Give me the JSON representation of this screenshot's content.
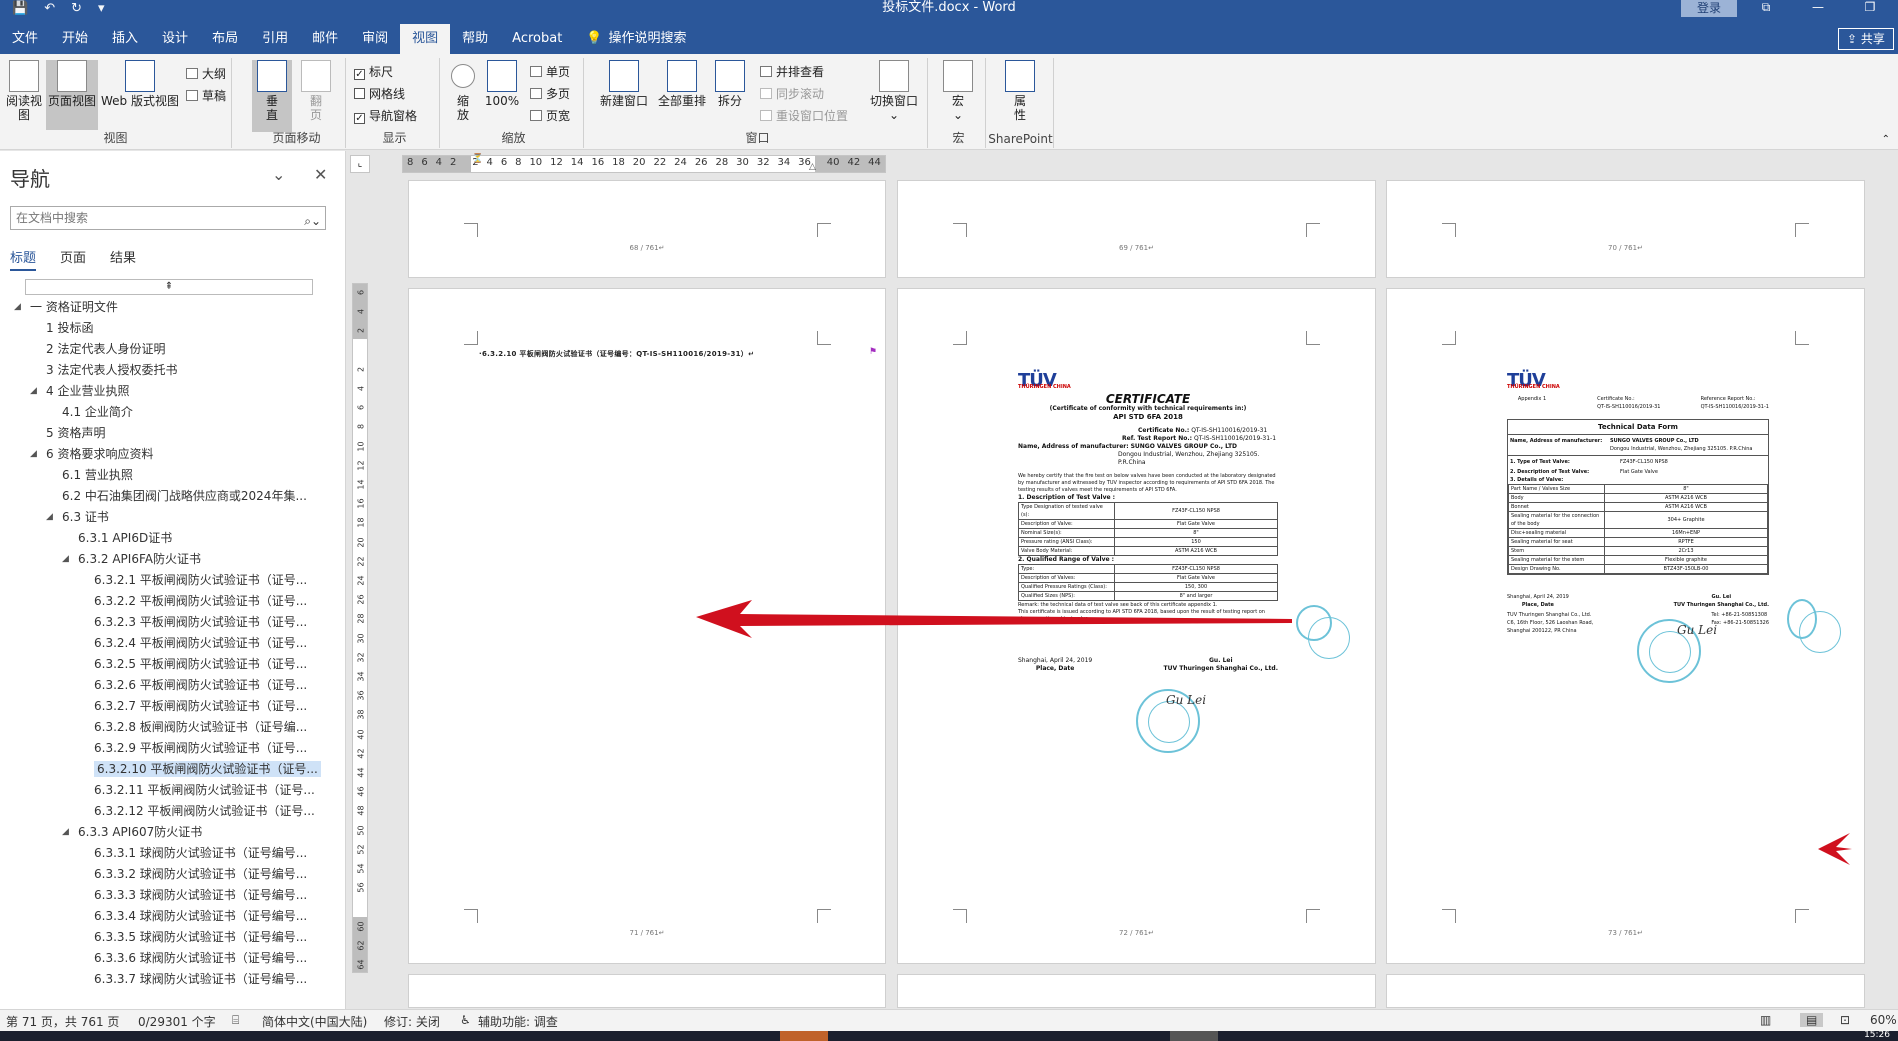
{
  "window": {
    "title": "投标文件.docx  -  Word",
    "login": "登录",
    "share": "共享"
  },
  "tabs": [
    {
      "label": "文件"
    },
    {
      "label": "开始"
    },
    {
      "label": "插入"
    },
    {
      "label": "设计"
    },
    {
      "label": "布局"
    },
    {
      "label": "引用"
    },
    {
      "label": "邮件"
    },
    {
      "label": "审阅"
    },
    {
      "label": "视图"
    },
    {
      "label": "帮助"
    },
    {
      "label": "Acrobat"
    },
    {
      "label": "操作说明搜索"
    }
  ],
  "ribbon": {
    "views": {
      "read": "阅读视图",
      "print": "页面视图",
      "web": "Web 版式视图",
      "outline": "大纲",
      "draft": "草稿",
      "label": "视图"
    },
    "page_move": {
      "vertical": "垂直",
      "side": "翻页",
      "label": "页面移动"
    },
    "show": {
      "ruler": "标尺",
      "gridlines": "网格线",
      "nav_pane": "导航窗格",
      "label": "显示"
    },
    "zoom": {
      "zoom": "缩放",
      "percent": "100%",
      "one_page": "单页",
      "multi_page": "多页",
      "page_width": "页宽",
      "label": "缩放"
    },
    "window": {
      "new_window": "新建窗口",
      "arrange_all": "全部重排",
      "split": "拆分",
      "side_by_side": "并排查看",
      "sync_scroll": "同步滚动",
      "reset_position": "重设窗口位置",
      "switch": "切换窗口",
      "label": "窗口"
    },
    "macros": {
      "macros": "宏",
      "label": "宏"
    },
    "sharepoint": {
      "properties": "属性",
      "label": "SharePoint"
    }
  },
  "nav": {
    "title": "导航",
    "search_placeholder": "在文档中搜索",
    "tabs": [
      "标题",
      "页面",
      "结果"
    ],
    "items": [
      {
        "text": "一 资格证明文件",
        "level": 0,
        "tri": "◢"
      },
      {
        "text": "1 投标函",
        "level": 1
      },
      {
        "text": "2 法定代表人身份证明",
        "level": 1
      },
      {
        "text": "3 法定代表人授权委托书",
        "level": 1
      },
      {
        "text": "4 企业营业执照",
        "level": 1,
        "tri": "◢"
      },
      {
        "text": "4.1 企业简介",
        "level": 2
      },
      {
        "text": "5 资格声明",
        "level": 1
      },
      {
        "text": "6 资格要求响应资料",
        "level": 1,
        "tri": "◢"
      },
      {
        "text": "6.1 营业执照",
        "level": 2
      },
      {
        "text": "6.2 中石油集团阀门战略供应商或2024年集...",
        "level": 2
      },
      {
        "text": "6.3 证书",
        "level": 2,
        "tri": "◢"
      },
      {
        "text": "6.3.1 API6D证书",
        "level": 3
      },
      {
        "text": "6.3.2 API6FA防火证书",
        "level": 3,
        "tri": "◢"
      },
      {
        "text": "6.3.2.1 平板闸阀防火试验证书（证号...",
        "level": 4
      },
      {
        "text": "6.3.2.2 平板闸阀防火试验证书（证号...",
        "level": 4
      },
      {
        "text": "6.3.2.3 平板闸阀防火试验证书（证号...",
        "level": 4
      },
      {
        "text": "6.3.2.4 平板闸阀防火试验证书（证号...",
        "level": 4
      },
      {
        "text": "6.3.2.5 平板闸阀防火试验证书（证号...",
        "level": 4
      },
      {
        "text": "6.3.2.6 平板闸阀防火试验证书（证号...",
        "level": 4
      },
      {
        "text": "6.3.2.7 平板闸阀防火试验证书（证号...",
        "level": 4
      },
      {
        "text": "6.3.2.8 板闸阀防火试验证书（证号编...",
        "level": 4
      },
      {
        "text": "6.3.2.9 平板闸阀防火试验证书（证号...",
        "level": 4
      },
      {
        "text": "6.3.2.10 平板闸阀防火试验证书（证号...",
        "level": 4,
        "selected": true
      },
      {
        "text": "6.3.2.11 平板闸阀防火试验证书（证号...",
        "level": 4
      },
      {
        "text": "6.3.2.12 平板闸阀防火试验证书（证号...",
        "level": 4
      },
      {
        "text": "6.3.3 API607防火证书",
        "level": 3,
        "tri": "◢"
      },
      {
        "text": "6.3.3.1 球阀防火试验证书（证号编号...",
        "level": 4
      },
      {
        "text": "6.3.3.2 球阀防火试验证书（证号编号...",
        "level": 4
      },
      {
        "text": "6.3.3.3 球阀防火试验证书（证号编号...",
        "level": 4
      },
      {
        "text": "6.3.3.4 球阀防火试验证书（证号编号...",
        "level": 4
      },
      {
        "text": "6.3.3.5 球阀防火试验证书（证号编号...",
        "level": 4
      },
      {
        "text": "6.3.3.6 球阀防火试验证书（证号编号...",
        "level": 4
      },
      {
        "text": "6.3.3.7 球阀防火试验证书（证号编号...",
        "level": 4
      }
    ]
  },
  "ruler": {
    "h_ticks": [
      "8",
      "6",
      "4",
      "2",
      "",
      "2",
      "4",
      "6",
      "8",
      "10",
      "12",
      "14",
      "16",
      "18",
      "20",
      "22",
      "24",
      "26",
      "28",
      "30",
      "32",
      "34",
      "36",
      "",
      "40",
      "42",
      "44"
    ],
    "v_ticks": [
      "6",
      "4",
      "2",
      "",
      "2",
      "4",
      "6",
      "8",
      "10",
      "12",
      "14",
      "16",
      "18",
      "20",
      "22",
      "24",
      "26",
      "28",
      "30",
      "32",
      "34",
      "36",
      "38",
      "40",
      "42",
      "44",
      "46",
      "48",
      "50",
      "52",
      "54",
      "56",
      "",
      "60",
      "62",
      "64"
    ]
  },
  "pages": {
    "p68": "68 / 761↵",
    "p69": "69 / 761↵",
    "p70": "70 / 761↵",
    "p71": "71 / 761↵",
    "p72": "72 / 761↵",
    "p73": "73 / 761↵",
    "heading": "·6.3.2.10    平板闸阀防火试验证书（证号编号：QT-IS-SH110016/2019-31）↵"
  },
  "certificate": {
    "brand": "TÜV",
    "brand_sub": "THÜRINGEN CHINA",
    "title": "CERTIFICATE",
    "subtitle": "(Certificate of conformity with technical requirements in:)",
    "standard": "API STD 6FA 2018",
    "cert_no_label": "Certificate No.:",
    "cert_no": "QT-IS-SH110016/2019-31",
    "report_no_label": "Ref. Test Report No.:",
    "report_no": "QT-IS-SH110016/2019-31-1",
    "mfr_label": "Name, Address of manufacturer:",
    "mfr": "SUNGO VALVES GROUP Co., LTD",
    "mfr_addr": "Dongou Industrial, Wenzhou, Zhejiang 325105. P.R.China",
    "body": "We hereby certify that the fire test on below valves have been conducted at the laboratory designated by manufacturer and witnessed by TUV inspector according to requirements of API STD 6FA 2018. The testing results of valves meet the requirements of API STD 6FA.",
    "sec1": "1. Description of Test Valve :",
    "rows1": [
      [
        "Type Designation of tested valve (s):",
        "FZ43F-CL150 NPS8"
      ],
      [
        "Description of Valve:",
        "Flat Gate Valve"
      ],
      [
        "Nominal Size(s):",
        "8\""
      ],
      [
        "Pressure rating (ANSI Class):",
        "150"
      ],
      [
        "Valve Body Material:",
        "ASTM A216 WCB"
      ]
    ],
    "sec2": "2. Qualified Range of Valve :",
    "rows2": [
      [
        "Type:",
        "FZ43F-CL150 NPS8"
      ],
      [
        "Description of Valves:",
        "Flat Gate Valve"
      ],
      [
        "Qualified Pressure Ratings (Class):",
        "150, 300"
      ],
      [
        "Qualified Sizes (NPS):",
        "8\" and larger"
      ]
    ],
    "remark": "Remark: the technical data of test valve see back of this certificate appendix 1.",
    "footer": "This certificate is issued according to API STD 6FA 2018, based upon the result of testing report on above mentioned test valve.",
    "place_date": "Shanghai, April 24, 2019",
    "place_label": "Place, Date",
    "signer": "Gu. Lei",
    "company": "TUV Thuringen Shanghai Co., Ltd.",
    "signature": "Gu Lei"
  },
  "tech_form": {
    "appendix": "Appendix 1",
    "cert_no_label": "Certificate No.:",
    "cert_no": "QT-IS-SH110016/2019-31",
    "report_label": "Reference Report No.:",
    "report_no": "QT-IS-SH110016/2019-31-1",
    "title": "Technical Data Form",
    "mfr_label": "Name, Address of manufacturer:",
    "mfr": "SUNGO VALVES GROUP Co., LTD",
    "mfr_addr": "Dongou Industrial, Wenzhou, Zhejiang 325105. P.R.China",
    "type_label": "1. Type of Test Valve:",
    "type": "FZ43F-CL150 NPS8",
    "desc_label": "2. Description of Test Valve:",
    "desc": "Flat Gate Valve",
    "details_label": "3. Details of Valve:",
    "size_label": "Valves Size",
    "part_label": "Part Name",
    "size": "8\"",
    "rows": [
      [
        "Body",
        "ASTM A216 WCB"
      ],
      [
        "Bonnet",
        "ASTM A216 WCB"
      ],
      [
        "Sealing material for the connection of the body",
        "304+ Graphite"
      ],
      [
        "Disc+sealing material",
        "16Mn+ENP"
      ],
      [
        "Sealing material for seat",
        "RPTFE"
      ],
      [
        "Stem",
        "2Cr13"
      ],
      [
        "Sealing material for the stem",
        "Flexible graphite"
      ],
      [
        "Design Drawing No.",
        "BTZ43F-150LB-00"
      ]
    ],
    "place_date": "Shanghai, April 24, 2019",
    "place_label": "Place, Date",
    "signer": "Gu. Lei",
    "company": "TUV Thuringen Shanghai Co., Ltd.",
    "addr1": "TUV Thuringen Shanghai Co., Ltd.",
    "addr2": "C6, 16th Floor, 526 Laoshan Road,",
    "addr3": "Shanghai 200122, PR China",
    "tel": "Tel: +86-21-50851308",
    "fax": "Fax: +86-21-50851326"
  },
  "status": {
    "page": "第 71 页，共 761 页",
    "words": "0/29301 个字",
    "lang": "简体中文(中国大陆)",
    "track": "修订: 关闭",
    "access": "辅助功能: 调查",
    "zoom": "60%",
    "clock": "15:26"
  },
  "colors": {
    "brand_blue": "#2b579a",
    "arrow_red": "#d0101e",
    "stamp_teal": "#48b4cf"
  }
}
